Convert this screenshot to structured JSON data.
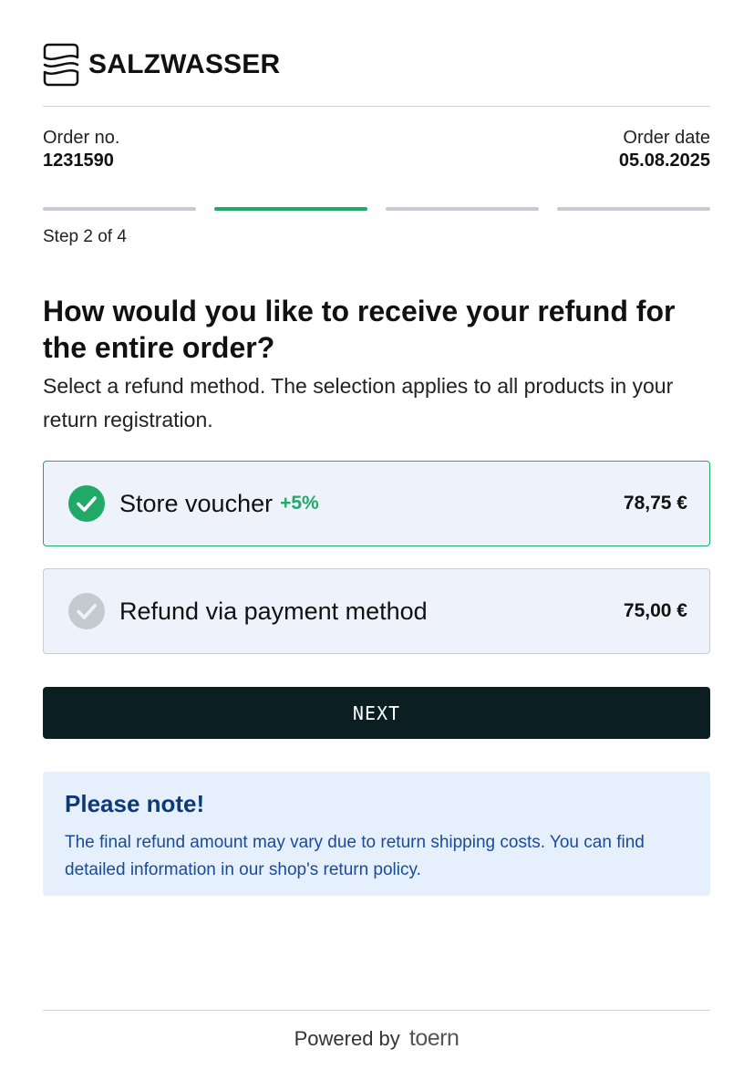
{
  "brand": {
    "name": "SALZWASSER"
  },
  "order": {
    "number_label": "Order no.",
    "number": "1231590",
    "date_label": "Order date",
    "date": "05.08.2025"
  },
  "progress": {
    "current_step": 2,
    "total_steps": 4,
    "step_text": "Step 2 of 4"
  },
  "question": {
    "title": "How would you like to receive your refund for the entire order?",
    "subtitle": "Select a refund method. The selection applies to all products in your return registration."
  },
  "options": [
    {
      "label": "Store voucher",
      "bonus": "+5%",
      "amount": "78,75 €",
      "selected": true
    },
    {
      "label": "Refund via payment method",
      "bonus": "",
      "amount": "75,00 €",
      "selected": false
    }
  ],
  "next_button": {
    "label": "NEXT"
  },
  "note": {
    "title": "Please note!",
    "text": "The final refund amount may vary due to return shipping costs. You can find detailed information in our shop's return policy."
  },
  "footer": {
    "powered_by": "Powered by",
    "provider": "toern"
  },
  "colors": {
    "accent": "#21a968",
    "button_bg": "#0b1f23",
    "note_bg": "#e6f0fd",
    "note_text": "#1a4a9a",
    "option_bg": "#eef2fa"
  }
}
